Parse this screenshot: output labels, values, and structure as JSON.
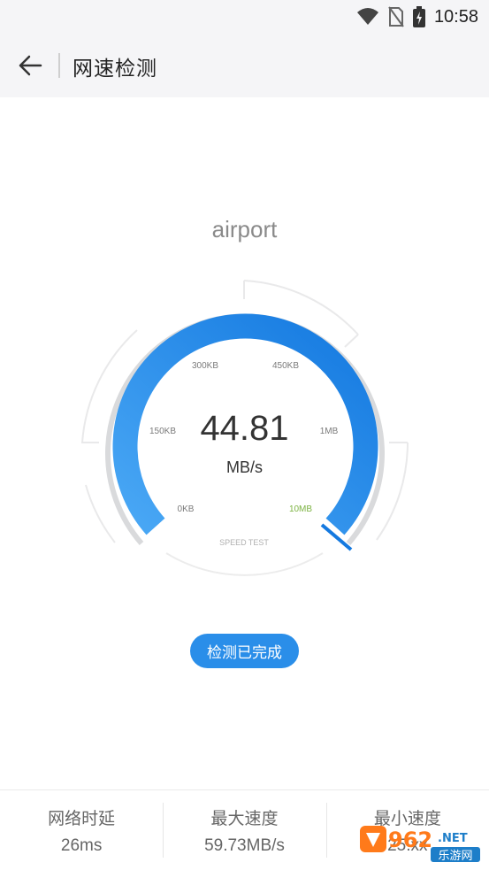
{
  "status_bar": {
    "time": "10:58"
  },
  "app_bar": {
    "title": "网速检测"
  },
  "network": {
    "name": "airport"
  },
  "gauge": {
    "value": "44.81",
    "unit": "MB/s",
    "ticks": [
      "0KB",
      "150KB",
      "300KB",
      "450KB",
      "1MB",
      "10MB"
    ],
    "caption": "SPEED TEST",
    "accent": "#2a8ee9",
    "highlight_tick_color": "#7cb342"
  },
  "status_button": {
    "label": "检测已完成"
  },
  "stats": [
    {
      "label": "网络时延",
      "value": "26ms"
    },
    {
      "label": "最大速度",
      "value": "59.73MB/s"
    },
    {
      "label": "最小速度",
      "value": "25.xx"
    }
  ],
  "watermark": {
    "text_top": "962",
    "text_net": ".NET",
    "text_bottom": "乐游网"
  }
}
